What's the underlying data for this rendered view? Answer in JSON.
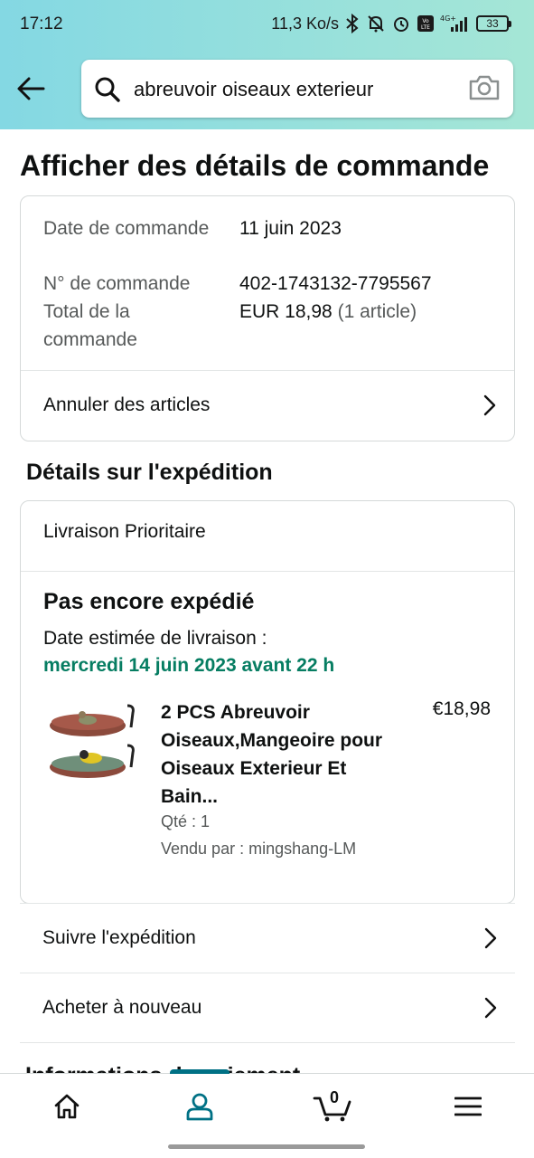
{
  "status_bar": {
    "time": "17:12",
    "network_speed": "11,3 Ko/s",
    "network_type": "4G+",
    "volte_label": "Vo LTE",
    "battery": "33"
  },
  "search": {
    "query": "abreuvoir oiseaux exterieur"
  },
  "page": {
    "title": "Afficher des détails de commande"
  },
  "order": {
    "date_label": "Date de commande",
    "date_value": "11 juin 2023",
    "number_label": "N° de commande",
    "number_value": "402-1743132-7795567",
    "total_label": "Total de la commande",
    "total_value": "EUR 18,98",
    "total_items": "(1 article)",
    "cancel_label": "Annuler des articles"
  },
  "shipping": {
    "section_title": "Détails sur l'expédition",
    "method": "Livraison Prioritaire",
    "status": "Pas encore expédié",
    "estimate_label": "Date estimée de livraison :",
    "estimate_date": "mercredi 14 juin 2023 avant 22 h",
    "accent_color": "#067d62",
    "product": {
      "title": "2 PCS Abreuvoir Oiseaux,Mangeoire pour Oiseaux Exterieur Et Bain...",
      "price": "€18,98",
      "qty": "Qté : 1",
      "seller": "Vendu par : mingshang-LM"
    }
  },
  "actions": {
    "track": "Suivre l'expédition",
    "buy_again": "Acheter à nouveau"
  },
  "peek_section": "Informations de paiement",
  "bottom_nav": {
    "cart_count": "0",
    "active_color": "#007185",
    "items": [
      "home-icon",
      "account-icon",
      "cart-icon",
      "menu-icon"
    ]
  }
}
